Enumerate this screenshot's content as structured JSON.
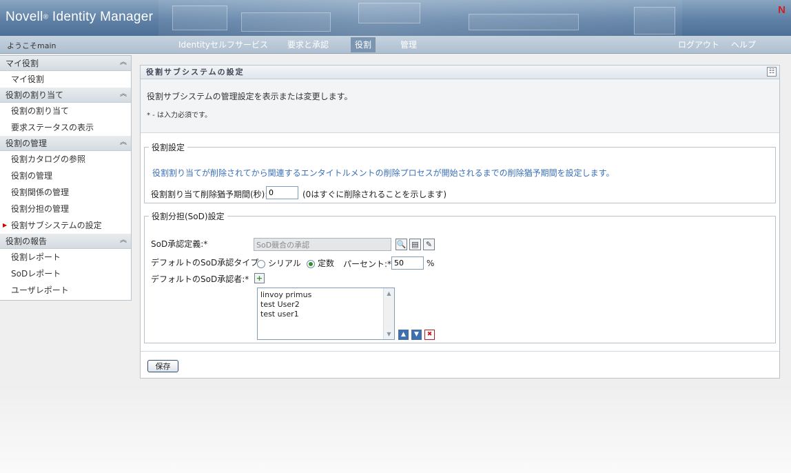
{
  "header": {
    "brand": "Novell",
    "brand_reg": "®",
    "brand_product": "Identity Manager",
    "logo_letter": "N"
  },
  "nav": {
    "welcome": "ようこそmain",
    "tabs": [
      {
        "label": "Identityセルフサービス"
      },
      {
        "label": "要求と承認"
      },
      {
        "label": "役割",
        "active": true
      },
      {
        "label": "管理"
      }
    ],
    "logout": "ログアウト",
    "help": "ヘルプ"
  },
  "sidebar": {
    "sections": [
      {
        "title": "マイ役割",
        "items": [
          "マイ役割"
        ]
      },
      {
        "title": "役割の割り当て",
        "items": [
          "役割の割り当て",
          "要求ステータスの表示"
        ]
      },
      {
        "title": "役割の管理",
        "items": [
          "役割カタログの参照",
          "役割の管理",
          "役割関係の管理",
          "役割分担の管理",
          "役割サブシステムの設定"
        ],
        "current": "役割サブシステムの設定"
      },
      {
        "title": "役割の報告",
        "items": [
          "役割レポート",
          "SoDレポート",
          "ユーザレポート"
        ]
      }
    ]
  },
  "panel": {
    "title": "役割サブシステムの設定",
    "description": "役割サブシステムの管理設定を表示または変更します。",
    "required_note": "* - は入力必須です。",
    "role_settings": {
      "legend": "役割設定",
      "info": "役割割り当てが削除されてから関連するエンタイトルメントの削除プロセスが開始されるまでの削除猶予期間を設定します。",
      "grace_label": "役割割り当て削除猶予期間(秒):",
      "grace_value": "0",
      "grace_hint": "(0はすぐに削除されることを示します)"
    },
    "sod_settings": {
      "legend": "役割分担(SoD)設定",
      "def_label": "SoD承認定義:*",
      "def_value": "SoD競合の承認",
      "type_label": "デフォルトのSoD承認タイプ:",
      "serial_label": "シリアル",
      "quorum_label": "定数",
      "percent_label": "パーセント:*",
      "percent_value": "50",
      "percent_unit": "%",
      "approvers_label": "デフォルトのSoD承認者:*",
      "approvers": [
        "linvoy primus",
        "test User2",
        "test user1"
      ]
    },
    "save_label": "保存"
  },
  "icons": {
    "accent": "#5f81a6",
    "logo_color": "#d0201c"
  }
}
